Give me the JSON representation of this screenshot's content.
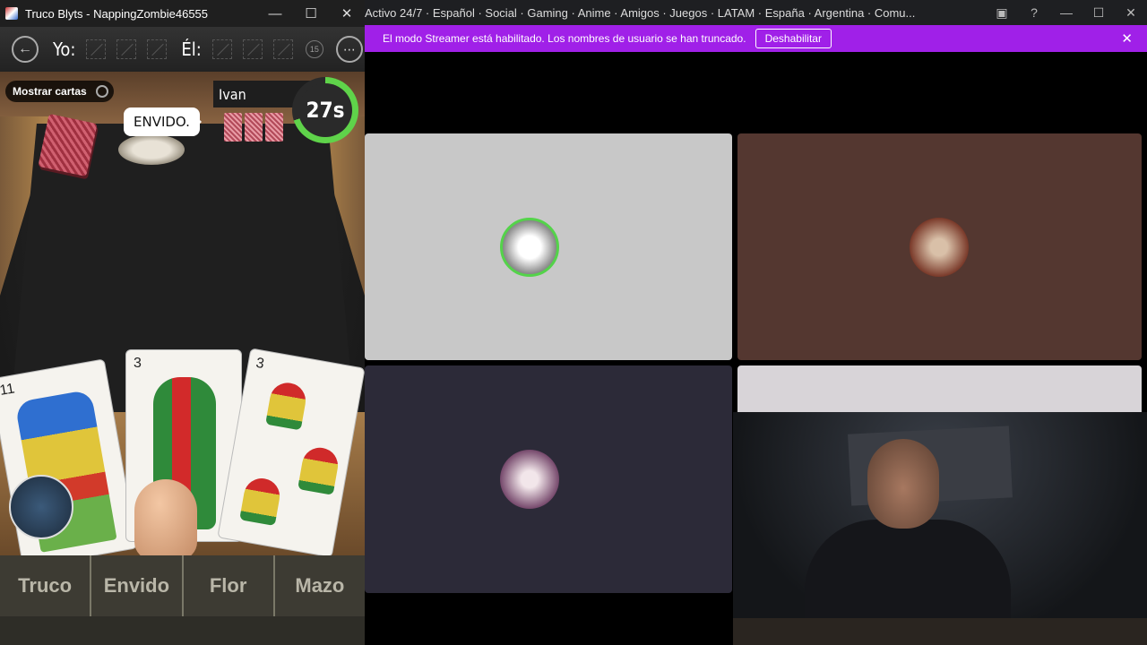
{
  "game_window": {
    "title": "Truco Blyts - NappingZombie46555",
    "controls": {
      "minimize": "—",
      "maximize": "☐",
      "close": "✕"
    }
  },
  "scorebar": {
    "me_label": "Yo:",
    "opponent_label": "Él:",
    "target_points": "15",
    "menu_icon": "⋯",
    "back_icon": "←"
  },
  "table": {
    "show_cards_label": "Mostrar cartas",
    "speech_bubble": "ENVIDO.",
    "opponent_name": "Ivan",
    "timer": "27s"
  },
  "hand": [
    {
      "number": "11",
      "suit": "espadas"
    },
    {
      "number": "3",
      "suit": "bastos"
    },
    {
      "number": "3",
      "suit": "copas"
    }
  ],
  "actions": [
    "Truco",
    "Envido",
    "Flor",
    "Mazo"
  ],
  "discord": {
    "title": "Activo 24/7 · Español · Social · Gaming · Anime · Amigos · Juegos · LATAM · España · Argentina · Comu...",
    "streamer_message": "El modo Streamer está habilitado. Los nombres de usuario se han truncado.",
    "disable_label": "Deshabilitar",
    "close_icon": "✕",
    "icons": {
      "screen": "▣",
      "help": "?",
      "minimize": "—",
      "maximize": "☐",
      "close": "✕"
    }
  },
  "colors": {
    "streamer_bar": "#a020e8",
    "timer_ring": "#5fd34a",
    "action_bar": "#3d3b33"
  }
}
